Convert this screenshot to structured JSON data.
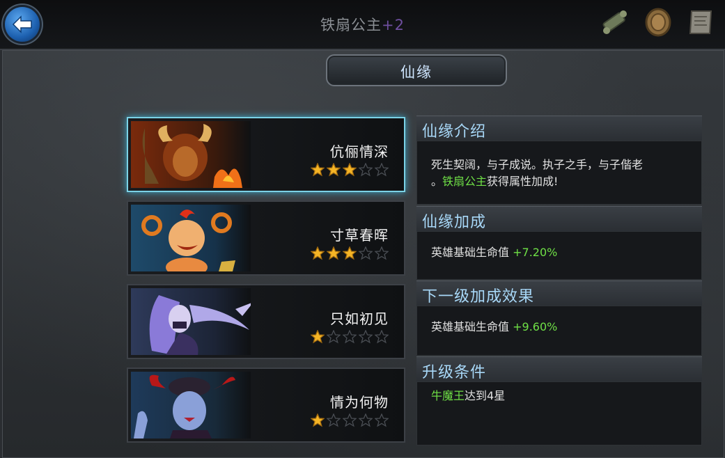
{
  "header": {
    "title": "铁扇公主",
    "level": "+2",
    "back_icon": "back-arrow-icon",
    "icons": [
      "scroll-icon",
      "coin-medal-icon",
      "map-scroll-icon"
    ]
  },
  "section": {
    "ribbon_label": "仙缘"
  },
  "fates": [
    {
      "name": "伉俪情深",
      "stars": 3,
      "max_stars": 5,
      "selected": true,
      "portrait": "bull-demon-portrait"
    },
    {
      "name": "寸草春晖",
      "stars": 3,
      "max_stars": 5,
      "selected": false,
      "portrait": "red-boy-portrait"
    },
    {
      "name": "只如初见",
      "stars": 1,
      "max_stars": 5,
      "selected": false,
      "portrait": "purple-hair-portrait"
    },
    {
      "name": "情为何物",
      "stars": 1,
      "max_stars": 5,
      "selected": false,
      "portrait": "horned-demoness-portrait"
    }
  ],
  "intro": {
    "header": "仙缘介绍",
    "line1": "死生契阔，与子成说。执子之手，与子偕老",
    "line2_prefix": "。",
    "line2_hero": "铁扇公主",
    "line2_suffix": "获得属性加成!"
  },
  "bonus": {
    "header": "仙缘加成",
    "stat": "英雄基础生命值",
    "value": "+7.20%"
  },
  "next": {
    "header": "下一级加成效果",
    "stat": "英雄基础生命值",
    "value": "+9.60%"
  },
  "upgrade": {
    "header": "升级条件",
    "hero": "牛魔王",
    "condition": "达到4星"
  },
  "colors": {
    "accent_green": "#6fe046",
    "header_blue": "#a8d8f8",
    "star_gold": "#f5b526",
    "selected_border": "#7bd2e6"
  }
}
